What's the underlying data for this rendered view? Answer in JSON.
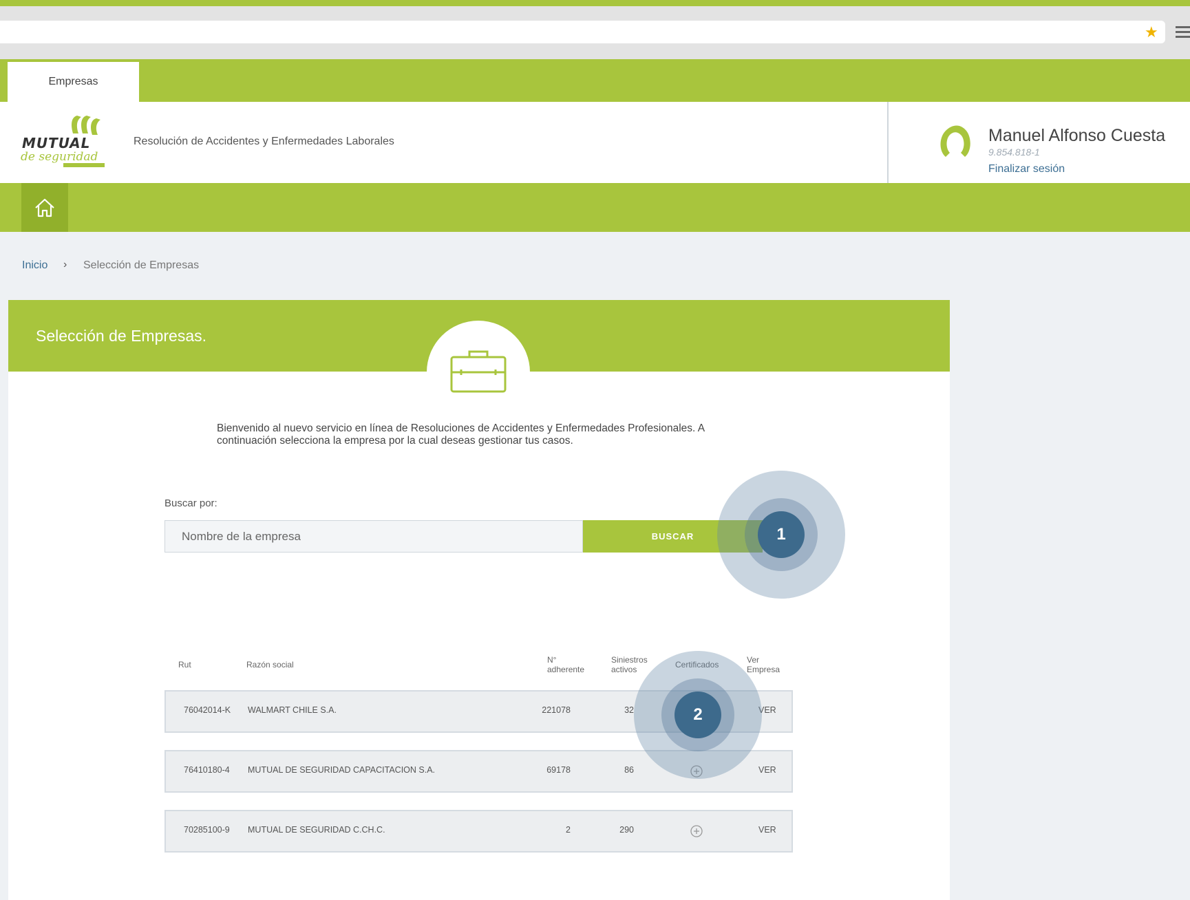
{
  "browser": {
    "star_icon": "star-icon",
    "menu_icon": "hamburger-menu-icon"
  },
  "tabs": [
    {
      "label": "Empresas"
    }
  ],
  "header": {
    "app_title": "Resolución de Accidentes y Enfermedades Laborales",
    "user": {
      "name": "Manuel Alfonso Cuesta",
      "rut": "9.854.818-1",
      "logout": "Finalizar sesión"
    }
  },
  "breadcrumb": {
    "home": "Inicio",
    "separator": "›",
    "current": "Selección de Empresas"
  },
  "page": {
    "title": "Selección de Empresas.",
    "intro_line1": "Bienvenido al nuevo servicio en línea de Resoluciones de Accidentes y Enfermedades Profesionales. A",
    "intro_line2": "continuación selecciona la empresa por la cual deseas gestionar tus casos."
  },
  "search": {
    "label": "Buscar por:",
    "placeholder": "Nombre de la empresa",
    "button": "BUSCAR"
  },
  "table": {
    "headers": {
      "rut": "Rut",
      "razon": "Razón social",
      "adherente_1": "N°",
      "adherente_2": "adherente",
      "siniestros_1": "Siniestros",
      "siniestros_2": "activos",
      "certificados": "Certificados",
      "ver_1": "Ver",
      "ver_2": "Empresa"
    },
    "rows": [
      {
        "rut": "76042014-K",
        "razon": "WALMART CHILE S.A.",
        "adherente": "221078",
        "siniestros": "32",
        "ver": "VER"
      },
      {
        "rut": "76410180-4",
        "razon": "MUTUAL DE SEGURIDAD CAPACITACION S.A.",
        "adherente": "69178",
        "siniestros": "86",
        "ver": "VER"
      },
      {
        "rut": "70285100-9",
        "razon": "MUTUAL DE SEGURIDAD C.CH.C.",
        "adherente": "2",
        "siniestros": "290",
        "ver": "VER"
      }
    ]
  },
  "callouts": [
    {
      "label": "1"
    },
    {
      "label": "2"
    }
  ],
  "colors": {
    "brand_green": "#a8c53d",
    "dark_green": "#91b02b",
    "link_blue": "#3c6e93",
    "callout_blue": "#3d6a8c"
  }
}
